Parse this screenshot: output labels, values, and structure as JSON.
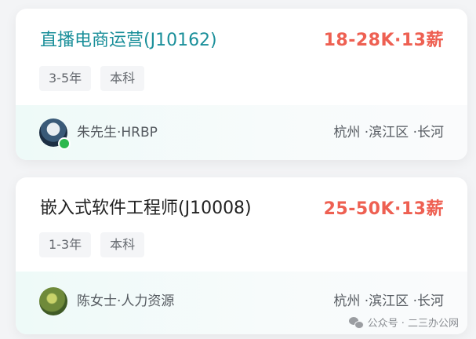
{
  "jobs": [
    {
      "title": "直播电商运营(J10162)",
      "salary": "18-28K·13薪",
      "tags": [
        "3-5年",
        "本科"
      ],
      "contact": "朱先生·HRBP",
      "contact_online": true,
      "location": "杭州 ·滨江区 ·长河"
    },
    {
      "title": "嵌入式软件工程师(J10008)",
      "salary": "25-50K·13薪",
      "tags": [
        "1-3年",
        "本科"
      ],
      "contact": "陈女士·人力资源",
      "contact_online": false,
      "location": "杭州 ·滨江区 ·长河"
    }
  ],
  "watermark": {
    "icon": "wechat-icon",
    "text": "公众号 · 二三办公网"
  },
  "colors": {
    "salary": "#ee6052",
    "active_title": "#1a8f9a",
    "online": "#2fb84e"
  }
}
